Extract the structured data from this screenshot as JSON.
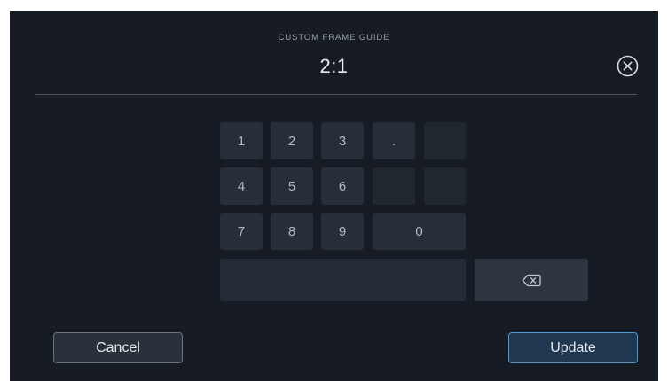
{
  "header": {
    "title": "CUSTOM FRAME GUIDE",
    "value": "2:1"
  },
  "keypad": {
    "keys": [
      "1",
      "2",
      "3",
      ".",
      "",
      "4",
      "5",
      "6",
      "",
      "",
      "7",
      "8",
      "9",
      "0"
    ],
    "disabled_keys": [
      4,
      8,
      9
    ]
  },
  "icons": {
    "close": "close-circle-icon",
    "backspace": "backspace-icon"
  },
  "actions": {
    "cancel_label": "Cancel",
    "update_label": "Update"
  },
  "colors": {
    "background": "#161b24",
    "key": "#262e3a",
    "accent": "#4f98d0"
  }
}
